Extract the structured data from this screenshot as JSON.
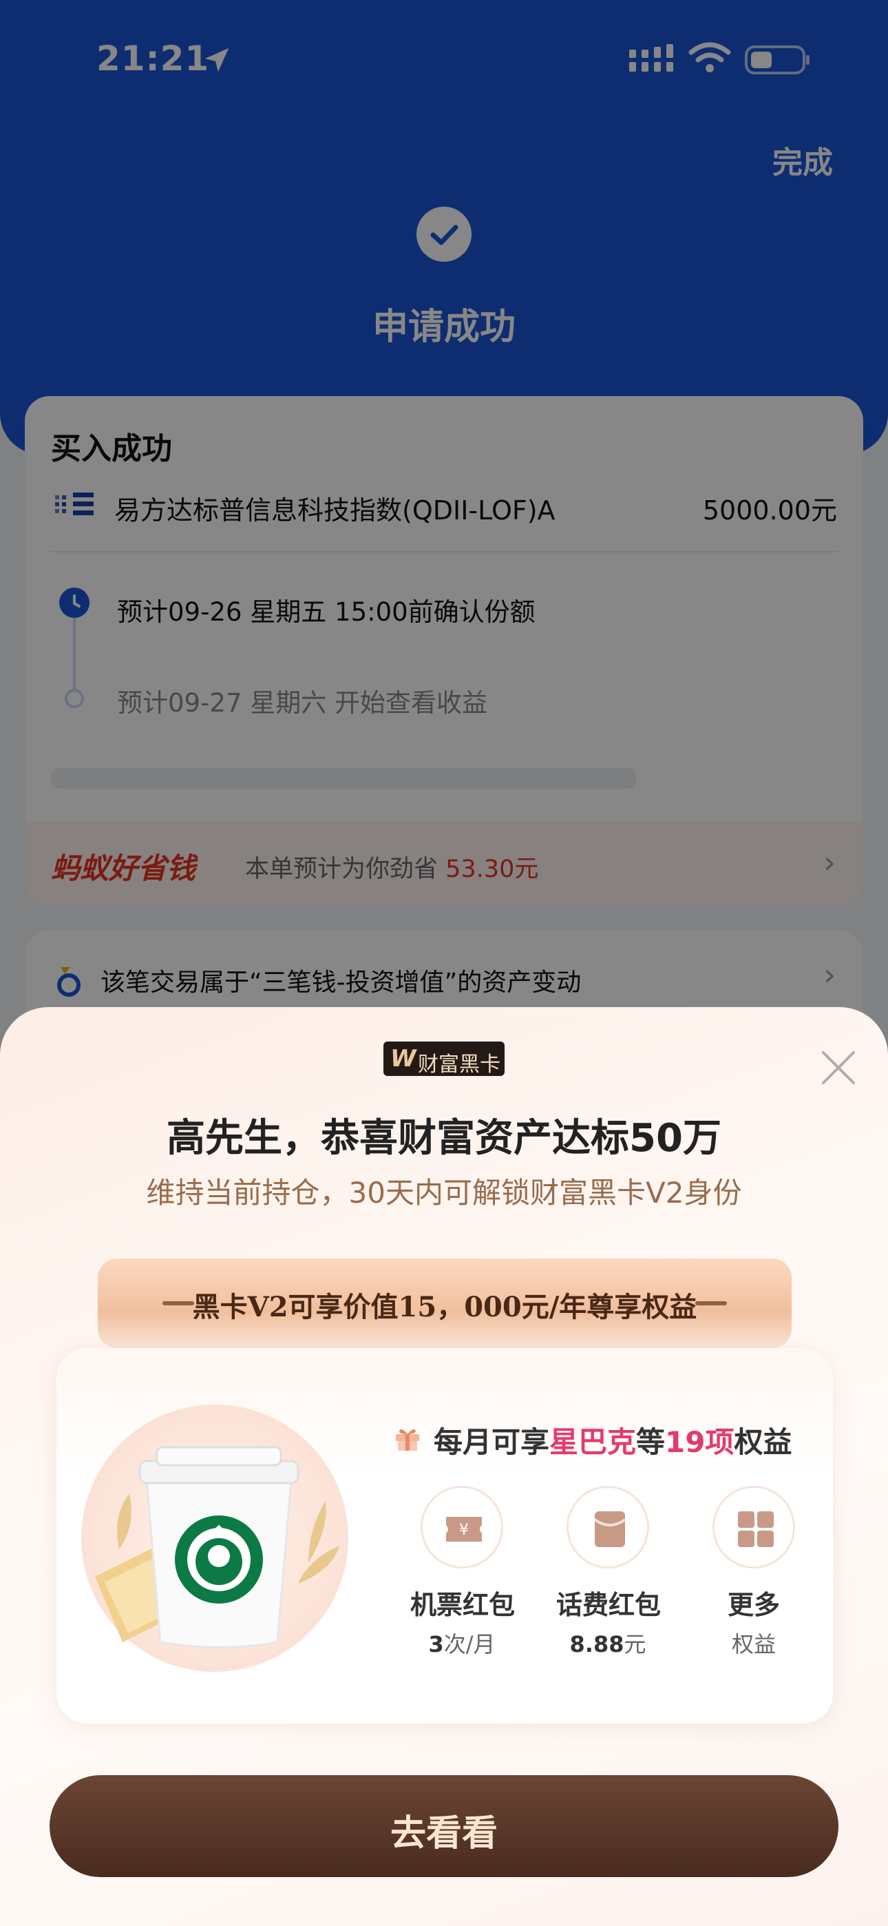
{
  "status_bar": {
    "time": "21:21"
  },
  "header": {
    "done_label": "完成",
    "title": "申请成功"
  },
  "purchase": {
    "title": "买入成功",
    "fund_name": "易方达标普信息科技指数(QDII-LOF)A",
    "amount": "5000.00元",
    "timeline": [
      {
        "text": "预计09-26 星期五 15:00前确认份额"
      },
      {
        "text": "预计09-27 星期六 开始查看收益"
      }
    ],
    "savings": {
      "brand": "蚂蚁好省钱",
      "text": "本单预计为你劲省",
      "amount": "53.30元"
    }
  },
  "asset_notice": {
    "text": "该笔交易属于“三笔钱-投资增值”的资产变动"
  },
  "sheet": {
    "badge": {
      "mark": "W",
      "text": "财富黑卡"
    },
    "title": "高先生，恭喜财富资产达标50万",
    "subtitle": "维持当前持仓，30天内可解锁财富黑卡V2身份",
    "ribbon": "黑卡V2可享价值15，000元/年尊享权益",
    "benefits_head": {
      "prefix": "每月可享",
      "brand": "星巴克",
      "mid": "等",
      "count": "19项",
      "suffix": "权益"
    },
    "benefits": [
      {
        "label": "机票红包",
        "value": "3",
        "unit": "次/月",
        "icon": "ticket-icon"
      },
      {
        "label": "话费红包",
        "value": "8.88",
        "unit": "元",
        "icon": "phone-bill-icon"
      },
      {
        "label": "更多",
        "value": "",
        "unit": "权益",
        "icon": "grid-icon"
      }
    ],
    "cta_label": "去看看"
  },
  "colors": {
    "header_blue": "#1b55d6",
    "accent_red": "#e8331f",
    "highlight_pink": "#e53a6b",
    "cta_brown": "#4a2b1f",
    "subtitle_brown": "#9a6c4c"
  }
}
